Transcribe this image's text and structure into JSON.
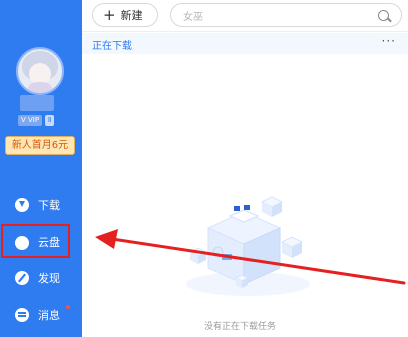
{
  "sidebar": {
    "vip_badge": "V VIP",
    "vip_level": "Ⅱ",
    "promo": "新人首月6元",
    "items": [
      {
        "label": "下载",
        "icon": "download-icon"
      },
      {
        "label": "云盘",
        "icon": "cloud-icon"
      },
      {
        "label": "发现",
        "icon": "compass-icon"
      },
      {
        "label": "消息",
        "icon": "message-icon"
      }
    ],
    "colors": {
      "background": "#2f7bf0",
      "highlight": "#e52020"
    }
  },
  "toolbar": {
    "new_label": "新建",
    "search_placeholder": "女巫"
  },
  "subtab": {
    "label": "正在下载",
    "more": "···"
  },
  "main": {
    "empty_text": "没有正在下载任务"
  },
  "annotation": {
    "arrow_color": "#e52020"
  }
}
